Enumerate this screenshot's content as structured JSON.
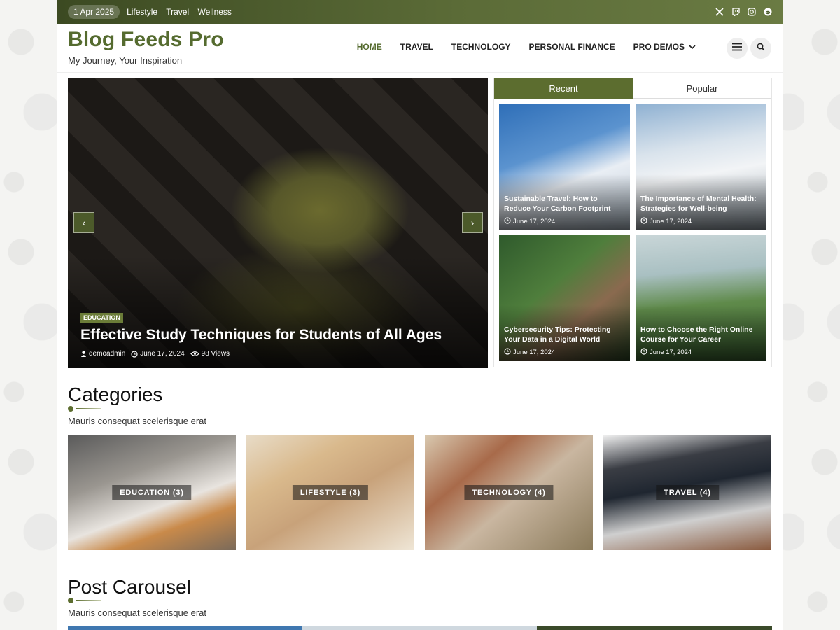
{
  "topbar": {
    "date": "1 Apr 2025",
    "links": [
      "Lifestyle",
      "Travel",
      "Wellness"
    ],
    "social_icons": [
      "x-icon",
      "twitch-icon",
      "instagram-icon",
      "reddit-icon"
    ]
  },
  "site": {
    "title": "Blog Feeds Pro",
    "tagline": "My Journey, Your Inspiration"
  },
  "nav": {
    "items": [
      "HOME",
      "TRAVEL",
      "TECHNOLOGY",
      "PERSONAL FINANCE",
      "PRO DEMOS"
    ],
    "active_index": 0
  },
  "header_icons": [
    "menu-icon",
    "search-icon"
  ],
  "hero": {
    "category": "EDUCATION",
    "title": "Effective Study Techniques for Students of All Ages",
    "author": "demoadmin",
    "date": "June 17, 2024",
    "views": "98 Views"
  },
  "tabs": {
    "recent": "Recent",
    "popular": "Popular",
    "active": "Recent"
  },
  "recent_posts": [
    {
      "title": "Sustainable Travel: How to Reduce Your Carbon Footprint",
      "date": "June 17, 2024"
    },
    {
      "title": "The Importance of Mental Health: Strategies for Well-being",
      "date": "June 17, 2024"
    },
    {
      "title": "Cybersecurity Tips: Protecting Your Data in a Digital World",
      "date": "June 17, 2024"
    },
    {
      "title": "How to Choose the Right Online Course for Your Career",
      "date": "June 17, 2024"
    }
  ],
  "categories": {
    "title": "Categories",
    "subtitle": "Mauris consequat scelerisque erat",
    "items": [
      "EDUCATION (3)",
      "LIFESTYLE (3)",
      "TECHNOLOGY (4)",
      "TRAVEL (4)"
    ]
  },
  "carousel": {
    "title": "Post Carousel",
    "subtitle": "Mauris consequat scelerisque erat"
  },
  "colors": {
    "accent": "#5c6d2f",
    "topbar": "#4a5a2b",
    "title": "#556b2f"
  }
}
